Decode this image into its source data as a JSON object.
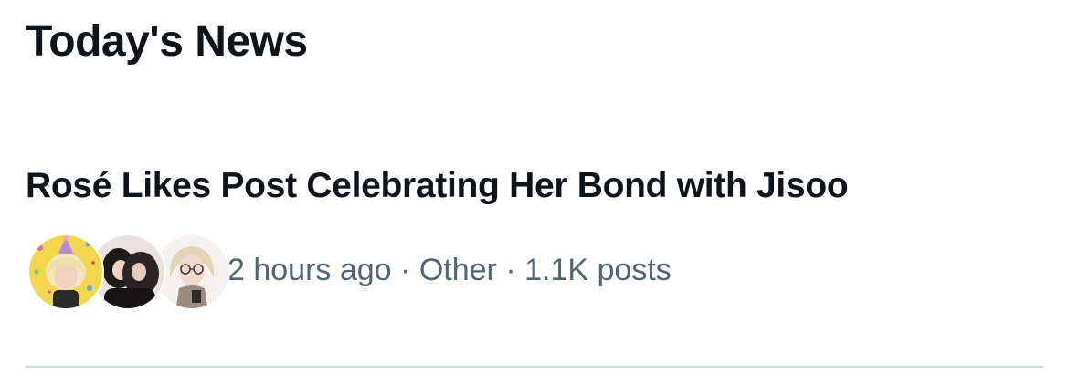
{
  "section": {
    "title": "Today's News"
  },
  "news_item": {
    "headline": "Rosé Likes Post Celebrating Her Bond with Jisoo",
    "avatars": [
      {
        "icon": "avatar-photo-blonde-party-hat"
      },
      {
        "icon": "avatar-photo-dark-hair-pair"
      },
      {
        "icon": "avatar-photo-glasses"
      }
    ],
    "meta": {
      "time": "2 hours ago",
      "separator": "·",
      "category": "Other",
      "posts": "1.1K posts"
    }
  },
  "colors": {
    "primary_text": "#0f1419",
    "secondary_text": "#536471",
    "divider": "#cfd9de",
    "background": "#ffffff"
  }
}
